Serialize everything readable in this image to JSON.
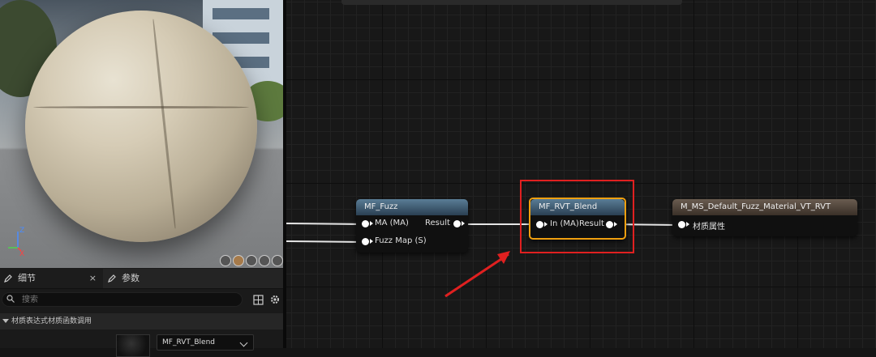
{
  "details_panel": {
    "tab_details": "细节",
    "tab_params": "参数",
    "close": "×",
    "search_placeholder": "搜索",
    "section_title": "材质表达式材质函数调用",
    "property_value": "MF_RVT_Blend"
  },
  "graph": {
    "nodes": {
      "fuzz": {
        "title": "MF_Fuzz",
        "input1": "MA (MA)",
        "input2": "Fuzz Map (S)",
        "output": "Result"
      },
      "rvt_blend": {
        "title": "MF_RVT_Blend",
        "input": "In (MA)",
        "output": "Result"
      },
      "material": {
        "title": "M_MS_Default_Fuzz_Material_VT_RVT",
        "input": "材质属性"
      }
    }
  },
  "colors": {
    "node_header_function": "#4f7390",
    "node_header_material": "#5e5248",
    "selection_outline": "#f0a010",
    "annotation_red": "#e02020"
  },
  "icons": [
    "search-icon",
    "grid-icon",
    "gear-icon",
    "pencil-icon",
    "axis-gizmo-icon",
    "chevron-down-icon",
    "arrow-annotation-icon"
  ]
}
